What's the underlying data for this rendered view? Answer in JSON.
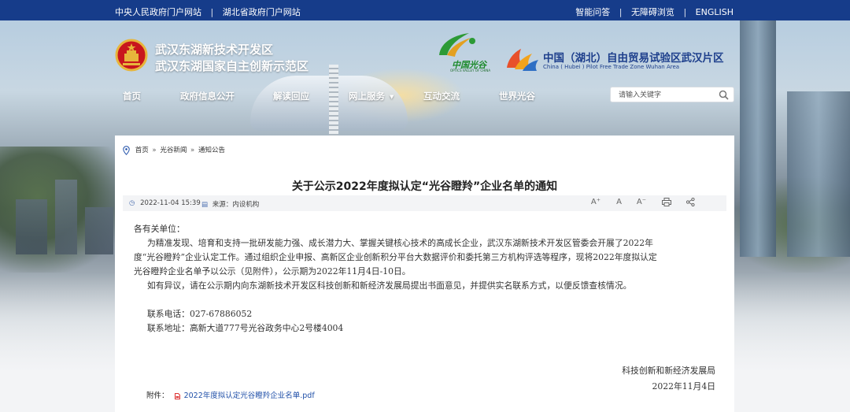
{
  "topbar": {
    "links_left": [
      "中央人民政府门户网站",
      "湖北省政府门户网站"
    ],
    "links_right": [
      "智能问答",
      "无障碍浏览",
      "ENGLISH"
    ]
  },
  "header": {
    "title_line1": "武汉东湖新技术开发区",
    "title_line2": "武汉东湖国家自主创新示范区",
    "optics_logo_cn": "中国光谷",
    "optics_logo_en": "OPTICS VALLEY OF CHINA",
    "ftz_title": "中国（湖北）自由贸易试验区武汉片区",
    "ftz_subtitle": "China ( Hubei ) Pilot Free Trade Zone Wuhan Area"
  },
  "nav": {
    "items": [
      "首页",
      "政府信息公开",
      "解读回应",
      "网上服务",
      "互动交流",
      "世界光谷"
    ]
  },
  "search": {
    "placeholder": "请输入关键字"
  },
  "breadcrumb": {
    "items": [
      "首页",
      "光谷新闻",
      "通知公告"
    ]
  },
  "article": {
    "title": "关于公示2022年度拟认定“光谷瞪羚”企业名单的通知",
    "date": "2022-11-04 15:39",
    "source_label": "来源：",
    "source_value": "内设机构",
    "tools": [
      "A⁺",
      "A",
      "A⁻",
      "print",
      "share"
    ],
    "salutation": "各有关单位：",
    "para1_line1": "为精准发现、培育和支持一批研发能力强、成长潜力大、掌握关键核心技术的高成长企业，武汉东湖新技术开发区管委会开展了2022年",
    "para1_line2": "度“光谷瞪羚”企业认定工作。通过组织企业申报、高新区企业创新积分平台大数据评价和委托第三方机构评选等程序，现将2022年度拟认定",
    "para1_line3": "光谷瞪羚企业名单予以公示（见附件），公示期为2022年11月4日-10日。",
    "para2": "如有异议，请在公示期内向东湖新技术开发区科技创新和新经济发展局提出书面意见，并提供实名联系方式，以便反馈查核情况。",
    "phone": "联系电话：027-67886052",
    "address": "联系地址：高新大道777号光谷政务中心2号楼4004",
    "org": "科技创新和新经济发展局",
    "sign_date": "2022年11月4日",
    "attachment_label": "附件：",
    "attachment_name": "2022年度拟认定光谷瞪羚企业名单.pdf"
  },
  "colors": {
    "topbar": "#163c8a",
    "ftz_blue": "#1d3f8c",
    "optics_green": "#1c8a2b",
    "link_blue": "#1f4fa8"
  }
}
